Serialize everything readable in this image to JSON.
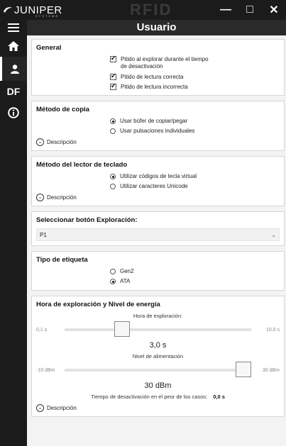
{
  "titlebar": {
    "brand": "JUNIPER",
    "brand_sub": "SYSTEMS",
    "product_mark": "RFID",
    "minimize": "—",
    "maximize": "□",
    "close": "✕"
  },
  "sidebar": {
    "items": [
      {
        "name": "menu-icon",
        "glyph": "☰"
      },
      {
        "name": "home-icon",
        "glyph": "⌂"
      },
      {
        "name": "user-icon",
        "glyph": "user",
        "active": true
      },
      {
        "name": "df-icon",
        "label": "DF"
      },
      {
        "name": "info-icon",
        "glyph": "i"
      }
    ]
  },
  "header": {
    "title": "Usuario"
  },
  "general": {
    "title": "General",
    "options": [
      {
        "label": "Pitido al explorar durante el tiempo de desactivación",
        "checked": true
      },
      {
        "label": "Pitido de lectura correcta",
        "checked": true
      },
      {
        "label": "Pitido de lectura incorrecta",
        "checked": true
      }
    ]
  },
  "copy_method": {
    "title": "Método de copia",
    "options": [
      {
        "label": "Usar búfer de copiar/pegar",
        "selected": true
      },
      {
        "label": "Usar pulsaciones individuales",
        "selected": false
      }
    ],
    "description": "Descripción"
  },
  "keyboard_method": {
    "title": "Método del lector de teclado",
    "options": [
      {
        "label": "Utilizar códigos de tecla virtual",
        "selected": true
      },
      {
        "label": "Utilizar caracteres Unicode",
        "selected": false
      }
    ],
    "description": "Descripción"
  },
  "scan_button": {
    "title": "Seleccionar botón Exploración:",
    "value": "P1"
  },
  "tag_type": {
    "title": "Tipo de etiqueta",
    "options": [
      {
        "label": "Gen2",
        "selected": false
      },
      {
        "label": "ATA",
        "selected": true
      }
    ]
  },
  "scan_power": {
    "title": "Hora de exploración y Nivel de energía",
    "scan_time": {
      "label": "Hora de exploración:",
      "min": "0,1 s",
      "max": "10,0 s",
      "value": "3,0 s",
      "level": 0.29
    },
    "power": {
      "label": "Nivel de alimentación",
      "min": "-10 dBm",
      "max": "30 dBm",
      "value": "30 dBm",
      "level": 1.0
    },
    "worst_case_label": "Tiempo de desactivación en el peor de los casos:",
    "worst_case_value": "0,0 s",
    "description": "Descripción"
  }
}
